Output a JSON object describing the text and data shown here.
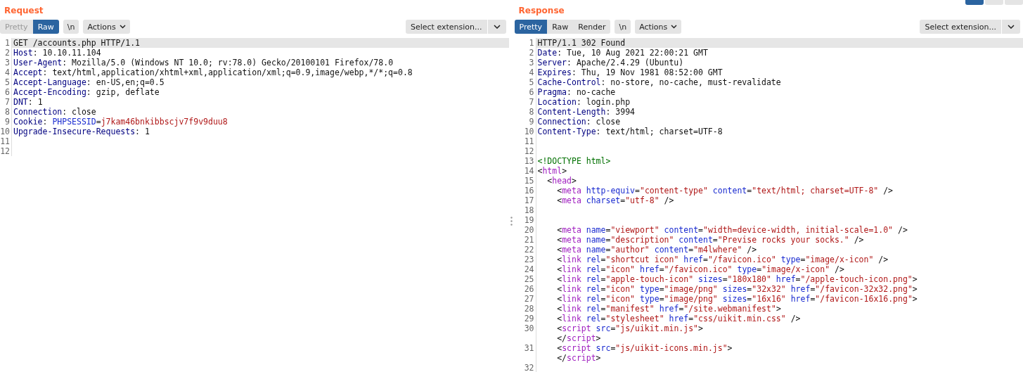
{
  "layout_buttons": [
    {
      "selected": true
    },
    {
      "selected": false
    },
    {
      "selected": false
    }
  ],
  "panes": [
    {
      "title": "Request",
      "view_tabs": [
        {
          "label": "Pretty",
          "selected": false
        },
        {
          "label": "Raw",
          "selected": true
        }
      ],
      "newline_toggle": "\\n",
      "actions": "Actions",
      "extension": "Select extension...",
      "lines": [
        {
          "number": "1",
          "selected": true,
          "rows": [
            [
              {
                "kind": "plain",
                "text": "GET /accounts.php HTTP/1.1"
              }
            ]
          ]
        },
        {
          "number": "2",
          "selected": false,
          "rows": [
            [
              {
                "kind": "header",
                "text": "Host"
              },
              {
                "kind": "plain",
                "text": ": 10.10.11.104"
              }
            ]
          ]
        },
        {
          "number": "3",
          "selected": false,
          "rows": [
            [
              {
                "kind": "header",
                "text": "User-Agent"
              },
              {
                "kind": "plain",
                "text": ": Mozilla/5.0 (Windows NT 10.0; rv:78.0) Gecko/20100101 Firefox/78.0"
              }
            ]
          ]
        },
        {
          "number": "4",
          "selected": false,
          "rows": [
            [
              {
                "kind": "header",
                "text": "Accept"
              },
              {
                "kind": "plain",
                "text": ": text/html,application/xhtml+xml,application/xml;q=0.9,image/webp,*/*;q=0.8"
              }
            ]
          ]
        },
        {
          "number": "5",
          "selected": false,
          "rows": [
            [
              {
                "kind": "header",
                "text": "Accept-Language"
              },
              {
                "kind": "plain",
                "text": ": en-US,en;q=0.5"
              }
            ]
          ]
        },
        {
          "number": "6",
          "selected": false,
          "rows": [
            [
              {
                "kind": "header",
                "text": "Accept-Encoding"
              },
              {
                "kind": "plain",
                "text": ": gzip, deflate"
              }
            ]
          ]
        },
        {
          "number": "7",
          "selected": false,
          "rows": [
            [
              {
                "kind": "header",
                "text": "DNT"
              },
              {
                "kind": "plain",
                "text": ": 1"
              }
            ]
          ]
        },
        {
          "number": "8",
          "selected": false,
          "rows": [
            [
              {
                "kind": "header",
                "text": "Connection"
              },
              {
                "kind": "plain",
                "text": ": close"
              }
            ]
          ]
        },
        {
          "number": "9",
          "selected": false,
          "rows": [
            [
              {
                "kind": "header",
                "text": "Cookie"
              },
              {
                "kind": "plain",
                "text": ": "
              },
              {
                "kind": "attr",
                "text": "PHPSESSID"
              },
              {
                "kind": "plain",
                "text": "="
              },
              {
                "kind": "value",
                "text": "j7kam46bnkibbscjv7f9v9duu8"
              }
            ]
          ]
        },
        {
          "number": "10",
          "selected": false,
          "rows": [
            [
              {
                "kind": "header",
                "text": "Upgrade-Insecure-Requests"
              },
              {
                "kind": "plain",
                "text": ": 1"
              }
            ]
          ]
        },
        {
          "number": "11",
          "selected": false
        },
        {
          "number": "12",
          "selected": false
        }
      ]
    },
    {
      "title": "Response",
      "view_tabs": [
        {
          "label": "Pretty",
          "selected": true
        },
        {
          "label": "Raw",
          "selected": false
        },
        {
          "label": "Render",
          "selected": false
        }
      ],
      "newline_toggle": "\\n",
      "actions": "Actions",
      "extension": "Select extension...",
      "lines": [
        {
          "number": "1",
          "selected": true,
          "rows": [
            [
              {
                "kind": "plain",
                "text": "HTTP/1.1 302 Found"
              }
            ]
          ]
        },
        {
          "number": "2",
          "selected": false,
          "rows": [
            [
              {
                "kind": "header",
                "text": "Date"
              },
              {
                "kind": "plain",
                "text": ": Tue, 10 Aug 2021 22:00:21 GMT"
              }
            ]
          ]
        },
        {
          "number": "3",
          "selected": false,
          "rows": [
            [
              {
                "kind": "header",
                "text": "Server"
              },
              {
                "kind": "plain",
                "text": ": Apache/2.4.29 (Ubuntu)"
              }
            ]
          ]
        },
        {
          "number": "4",
          "selected": false,
          "rows": [
            [
              {
                "kind": "header",
                "text": "Expires"
              },
              {
                "kind": "plain",
                "text": ": Thu, 19 Nov 1981 08:52:00 GMT"
              }
            ]
          ]
        },
        {
          "number": "5",
          "selected": false,
          "rows": [
            [
              {
                "kind": "header",
                "text": "Cache-Control"
              },
              {
                "kind": "plain",
                "text": ": no-store, no-cache, must-revalidate"
              }
            ]
          ]
        },
        {
          "number": "6",
          "selected": false,
          "rows": [
            [
              {
                "kind": "header",
                "text": "Pragma"
              },
              {
                "kind": "plain",
                "text": ": no-cache"
              }
            ]
          ]
        },
        {
          "number": "7",
          "selected": false,
          "rows": [
            [
              {
                "kind": "header",
                "text": "Location"
              },
              {
                "kind": "plain",
                "text": ": login.php"
              }
            ]
          ]
        },
        {
          "number": "8",
          "selected": false,
          "rows": [
            [
              {
                "kind": "header",
                "text": "Content-Length"
              },
              {
                "kind": "plain",
                "text": ": 3994"
              }
            ]
          ]
        },
        {
          "number": "9",
          "selected": false,
          "rows": [
            [
              {
                "kind": "header",
                "text": "Connection"
              },
              {
                "kind": "plain",
                "text": ": close"
              }
            ]
          ]
        },
        {
          "number": "10",
          "selected": false,
          "rows": [
            [
              {
                "kind": "header",
                "text": "Content-Type"
              },
              {
                "kind": "plain",
                "text": ": text/html; charset=UTF-8"
              }
            ]
          ]
        },
        {
          "number": "11",
          "selected": false
        },
        {
          "number": "12",
          "selected": false
        },
        {
          "number": "13",
          "selected": false,
          "rows": [
            [
              {
                "kind": "doctype",
                "text": "<!DOCTYPE html>"
              }
            ]
          ]
        },
        {
          "number": "14",
          "selected": false,
          "rows": [
            [
              {
                "kind": "plain",
                "text": "<"
              },
              {
                "kind": "tag",
                "text": "html"
              },
              {
                "kind": "plain",
                "text": ">"
              }
            ]
          ]
        },
        {
          "number": "15",
          "selected": false,
          "rows": [
            [
              {
                "kind": "plain",
                "text": "  <"
              },
              {
                "kind": "tag",
                "text": "head"
              },
              {
                "kind": "plain",
                "text": ">"
              }
            ]
          ]
        },
        {
          "number": "16",
          "selected": false,
          "rows": [
            [
              {
                "kind": "plain",
                "text": "    <"
              },
              {
                "kind": "tag",
                "text": "meta"
              },
              {
                "kind": "plain",
                "text": " "
              },
              {
                "kind": "attr",
                "text": "http-equiv"
              },
              {
                "kind": "plain",
                "text": "="
              },
              {
                "kind": "value",
                "text": "\"content-type\""
              },
              {
                "kind": "plain",
                "text": " "
              },
              {
                "kind": "attr",
                "text": "content"
              },
              {
                "kind": "plain",
                "text": "="
              },
              {
                "kind": "value",
                "text": "\"text/html; charset=UTF-8\""
              },
              {
                "kind": "plain",
                "text": " />"
              }
            ]
          ]
        },
        {
          "number": "17",
          "selected": false,
          "rows": [
            [
              {
                "kind": "plain",
                "text": "    <"
              },
              {
                "kind": "tag",
                "text": "meta"
              },
              {
                "kind": "plain",
                "text": " "
              },
              {
                "kind": "attr",
                "text": "charset"
              },
              {
                "kind": "plain",
                "text": "="
              },
              {
                "kind": "value",
                "text": "\"utf-8\""
              },
              {
                "kind": "plain",
                "text": " />"
              }
            ]
          ]
        },
        {
          "number": "18",
          "selected": false
        },
        {
          "number": "19",
          "selected": false
        },
        {
          "number": "20",
          "selected": false,
          "rows": [
            [
              {
                "kind": "plain",
                "text": "    <"
              },
              {
                "kind": "tag",
                "text": "meta"
              },
              {
                "kind": "plain",
                "text": " "
              },
              {
                "kind": "attr",
                "text": "name"
              },
              {
                "kind": "plain",
                "text": "="
              },
              {
                "kind": "value",
                "text": "\"viewport\""
              },
              {
                "kind": "plain",
                "text": " "
              },
              {
                "kind": "attr",
                "text": "content"
              },
              {
                "kind": "plain",
                "text": "="
              },
              {
                "kind": "value",
                "text": "\"width=device-width, initial-scale=1.0\""
              },
              {
                "kind": "plain",
                "text": " />"
              }
            ]
          ]
        },
        {
          "number": "21",
          "selected": false,
          "rows": [
            [
              {
                "kind": "plain",
                "text": "    <"
              },
              {
                "kind": "tag",
                "text": "meta"
              },
              {
                "kind": "plain",
                "text": " "
              },
              {
                "kind": "attr",
                "text": "name"
              },
              {
                "kind": "plain",
                "text": "="
              },
              {
                "kind": "value",
                "text": "\"description\""
              },
              {
                "kind": "plain",
                "text": " "
              },
              {
                "kind": "attr",
                "text": "content"
              },
              {
                "kind": "plain",
                "text": "="
              },
              {
                "kind": "value",
                "text": "\"Previse rocks your socks.\""
              },
              {
                "kind": "plain",
                "text": " />"
              }
            ]
          ]
        },
        {
          "number": "22",
          "selected": false,
          "rows": [
            [
              {
                "kind": "plain",
                "text": "    <"
              },
              {
                "kind": "tag",
                "text": "meta"
              },
              {
                "kind": "plain",
                "text": " "
              },
              {
                "kind": "attr",
                "text": "name"
              },
              {
                "kind": "plain",
                "text": "="
              },
              {
                "kind": "value",
                "text": "\"author\""
              },
              {
                "kind": "plain",
                "text": " "
              },
              {
                "kind": "attr",
                "text": "content"
              },
              {
                "kind": "plain",
                "text": "="
              },
              {
                "kind": "value",
                "text": "\"m4lwhere\""
              },
              {
                "kind": "plain",
                "text": " />"
              }
            ]
          ]
        },
        {
          "number": "23",
          "selected": false,
          "rows": [
            [
              {
                "kind": "plain",
                "text": "    <"
              },
              {
                "kind": "tag",
                "text": "link"
              },
              {
                "kind": "plain",
                "text": " "
              },
              {
                "kind": "attr",
                "text": "rel"
              },
              {
                "kind": "plain",
                "text": "="
              },
              {
                "kind": "value",
                "text": "\"shortcut icon\""
              },
              {
                "kind": "plain",
                "text": " "
              },
              {
                "kind": "attr",
                "text": "href"
              },
              {
                "kind": "plain",
                "text": "="
              },
              {
                "kind": "value",
                "text": "\"/favicon.ico\""
              },
              {
                "kind": "plain",
                "text": " "
              },
              {
                "kind": "attr",
                "text": "type"
              },
              {
                "kind": "plain",
                "text": "="
              },
              {
                "kind": "value",
                "text": "\"image/x-icon\""
              },
              {
                "kind": "plain",
                "text": " />"
              }
            ]
          ]
        },
        {
          "number": "24",
          "selected": false,
          "rows": [
            [
              {
                "kind": "plain",
                "text": "    <"
              },
              {
                "kind": "tag",
                "text": "link"
              },
              {
                "kind": "plain",
                "text": " "
              },
              {
                "kind": "attr",
                "text": "rel"
              },
              {
                "kind": "plain",
                "text": "="
              },
              {
                "kind": "value",
                "text": "\"icon\""
              },
              {
                "kind": "plain",
                "text": " "
              },
              {
                "kind": "attr",
                "text": "href"
              },
              {
                "kind": "plain",
                "text": "="
              },
              {
                "kind": "value",
                "text": "\"/favicon.ico\""
              },
              {
                "kind": "plain",
                "text": " "
              },
              {
                "kind": "attr",
                "text": "type"
              },
              {
                "kind": "plain",
                "text": "="
              },
              {
                "kind": "value",
                "text": "\"image/x-icon\""
              },
              {
                "kind": "plain",
                "text": " />"
              }
            ]
          ]
        },
        {
          "number": "25",
          "selected": false,
          "rows": [
            [
              {
                "kind": "plain",
                "text": "    <"
              },
              {
                "kind": "tag",
                "text": "link"
              },
              {
                "kind": "plain",
                "text": " "
              },
              {
                "kind": "attr",
                "text": "rel"
              },
              {
                "kind": "plain",
                "text": "="
              },
              {
                "kind": "value",
                "text": "\"apple-touch-icon\""
              },
              {
                "kind": "plain",
                "text": " "
              },
              {
                "kind": "attr",
                "text": "sizes"
              },
              {
                "kind": "plain",
                "text": "="
              },
              {
                "kind": "value",
                "text": "\"180x180\""
              },
              {
                "kind": "plain",
                "text": " "
              },
              {
                "kind": "attr",
                "text": "href"
              },
              {
                "kind": "plain",
                "text": "="
              },
              {
                "kind": "value",
                "text": "\"/apple-touch-icon.png\""
              },
              {
                "kind": "plain",
                "text": ">"
              }
            ]
          ]
        },
        {
          "number": "26",
          "selected": false,
          "rows": [
            [
              {
                "kind": "plain",
                "text": "    <"
              },
              {
                "kind": "tag",
                "text": "link"
              },
              {
                "kind": "plain",
                "text": " "
              },
              {
                "kind": "attr",
                "text": "rel"
              },
              {
                "kind": "plain",
                "text": "="
              },
              {
                "kind": "value",
                "text": "\"icon\""
              },
              {
                "kind": "plain",
                "text": " "
              },
              {
                "kind": "attr",
                "text": "type"
              },
              {
                "kind": "plain",
                "text": "="
              },
              {
                "kind": "value",
                "text": "\"image/png\""
              },
              {
                "kind": "plain",
                "text": " "
              },
              {
                "kind": "attr",
                "text": "sizes"
              },
              {
                "kind": "plain",
                "text": "="
              },
              {
                "kind": "value",
                "text": "\"32x32\""
              },
              {
                "kind": "plain",
                "text": " "
              },
              {
                "kind": "attr",
                "text": "href"
              },
              {
                "kind": "plain",
                "text": "="
              },
              {
                "kind": "value",
                "text": "\"/favicon-32x32.png\""
              },
              {
                "kind": "plain",
                "text": ">"
              }
            ]
          ]
        },
        {
          "number": "27",
          "selected": false,
          "rows": [
            [
              {
                "kind": "plain",
                "text": "    <"
              },
              {
                "kind": "tag",
                "text": "link"
              },
              {
                "kind": "plain",
                "text": " "
              },
              {
                "kind": "attr",
                "text": "rel"
              },
              {
                "kind": "plain",
                "text": "="
              },
              {
                "kind": "value",
                "text": "\"icon\""
              },
              {
                "kind": "plain",
                "text": " "
              },
              {
                "kind": "attr",
                "text": "type"
              },
              {
                "kind": "plain",
                "text": "="
              },
              {
                "kind": "value",
                "text": "\"image/png\""
              },
              {
                "kind": "plain",
                "text": " "
              },
              {
                "kind": "attr",
                "text": "sizes"
              },
              {
                "kind": "plain",
                "text": "="
              },
              {
                "kind": "value",
                "text": "\"16x16\""
              },
              {
                "kind": "plain",
                "text": " "
              },
              {
                "kind": "attr",
                "text": "href"
              },
              {
                "kind": "plain",
                "text": "="
              },
              {
                "kind": "value",
                "text": "\"/favicon-16x16.png\""
              },
              {
                "kind": "plain",
                "text": ">"
              }
            ]
          ]
        },
        {
          "number": "28",
          "selected": false,
          "rows": [
            [
              {
                "kind": "plain",
                "text": "    <"
              },
              {
                "kind": "tag",
                "text": "link"
              },
              {
                "kind": "plain",
                "text": " "
              },
              {
                "kind": "attr",
                "text": "rel"
              },
              {
                "kind": "plain",
                "text": "="
              },
              {
                "kind": "value",
                "text": "\"manifest\""
              },
              {
                "kind": "plain",
                "text": " "
              },
              {
                "kind": "attr",
                "text": "href"
              },
              {
                "kind": "plain",
                "text": "="
              },
              {
                "kind": "value",
                "text": "\"/site.webmanifest\""
              },
              {
                "kind": "plain",
                "text": ">"
              }
            ]
          ]
        },
        {
          "number": "29",
          "selected": false,
          "rows": [
            [
              {
                "kind": "plain",
                "text": "    <"
              },
              {
                "kind": "tag",
                "text": "link"
              },
              {
                "kind": "plain",
                "text": " "
              },
              {
                "kind": "attr",
                "text": "rel"
              },
              {
                "kind": "plain",
                "text": "="
              },
              {
                "kind": "value",
                "text": "\"stylesheet\""
              },
              {
                "kind": "plain",
                "text": " "
              },
              {
                "kind": "attr",
                "text": "href"
              },
              {
                "kind": "plain",
                "text": "="
              },
              {
                "kind": "value",
                "text": "\"css/uikit.min.css\""
              },
              {
                "kind": "plain",
                "text": " />"
              }
            ]
          ]
        },
        {
          "number": "30",
          "selected": false,
          "rows": [
            [
              {
                "kind": "plain",
                "text": "    <"
              },
              {
                "kind": "tag",
                "text": "script"
              },
              {
                "kind": "plain",
                "text": " "
              },
              {
                "kind": "attr",
                "text": "src"
              },
              {
                "kind": "plain",
                "text": "="
              },
              {
                "kind": "value",
                "text": "\"js/uikit.min.js\""
              },
              {
                "kind": "plain",
                "text": ">"
              }
            ],
            [
              {
                "kind": "plain",
                "text": "    </"
              },
              {
                "kind": "tag",
                "text": "script"
              },
              {
                "kind": "plain",
                "text": ">"
              }
            ]
          ]
        },
        {
          "number": "31",
          "selected": false,
          "rows": [
            [
              {
                "kind": "plain",
                "text": "    <"
              },
              {
                "kind": "tag",
                "text": "script"
              },
              {
                "kind": "plain",
                "text": " "
              },
              {
                "kind": "attr",
                "text": "src"
              },
              {
                "kind": "plain",
                "text": "="
              },
              {
                "kind": "value",
                "text": "\"js/uikit-icons.min.js\""
              },
              {
                "kind": "plain",
                "text": ">"
              }
            ],
            [
              {
                "kind": "plain",
                "text": "    </"
              },
              {
                "kind": "tag",
                "text": "script"
              },
              {
                "kind": "plain",
                "text": ">"
              }
            ]
          ]
        },
        {
          "number": "32",
          "selected": false
        }
      ]
    }
  ]
}
